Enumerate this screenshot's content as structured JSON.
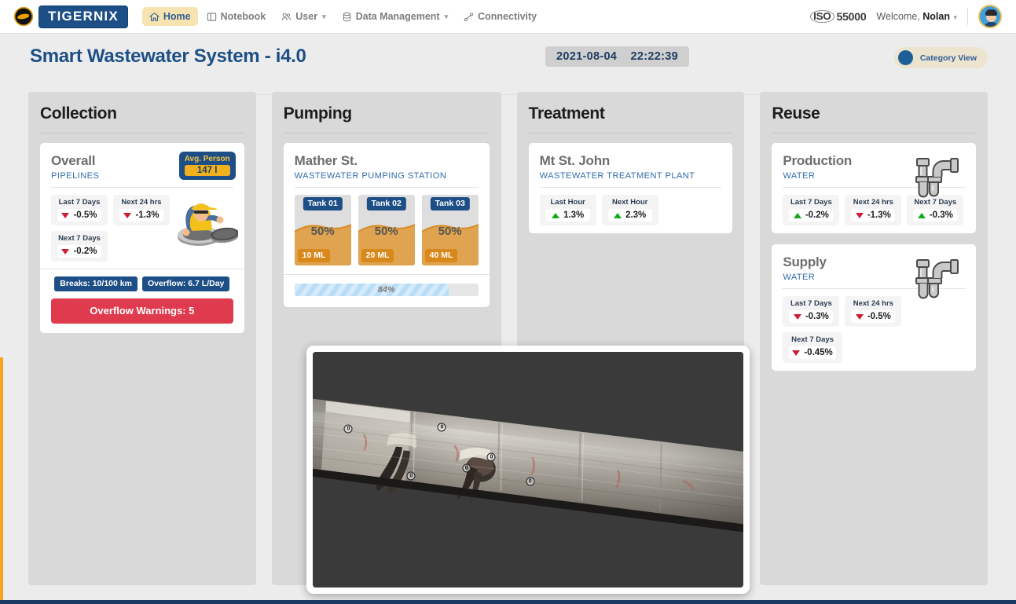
{
  "navbar": {
    "brand_name": "TIGERNIX",
    "links": [
      {
        "label": "Home",
        "icon": "home-icon",
        "active": true,
        "caret": false
      },
      {
        "label": "Notebook",
        "icon": "notebook-icon",
        "active": false,
        "caret": false
      },
      {
        "label": "User",
        "icon": "users-icon",
        "active": false,
        "caret": true
      },
      {
        "label": "Data Management",
        "icon": "database-icon",
        "active": false,
        "caret": true
      },
      {
        "label": "Connectivity",
        "icon": "connectivity-icon",
        "active": false,
        "caret": false
      }
    ],
    "iso_seal": "ISO",
    "iso_number": "55000",
    "welcome_prefix": "Welcome,",
    "user_name": "Nolan"
  },
  "header": {
    "title": "Smart Wastewater System - i4.0",
    "date": "2021-08-04",
    "time": "22:22:39",
    "category_view_label": "Category View",
    "accent_color": "#1d4f86",
    "title_color": "#1d4f86"
  },
  "panels": [
    {
      "name": "Collection",
      "cards": [
        {
          "type": "collection",
          "title": "Overall",
          "subtitle": "PIPELINES",
          "avg_badge_title": "Avg. Person",
          "avg_badge_value": "147 l",
          "chips": [
            {
              "label": "Last 7 Days",
              "value": "-0.5%",
              "dir": "down"
            },
            {
              "label": "Next 24 hrs",
              "value": "-1.3%",
              "dir": "down"
            },
            {
              "label": "Next 7 Days",
              "value": "-0.2%",
              "dir": "down"
            }
          ],
          "badges": [
            "Breaks: 10/100 km",
            "Overflow: 6.7 L/Day"
          ],
          "warning_button": "Overflow Warnings: 5",
          "warning_color": "#e03a4e"
        }
      ]
    },
    {
      "name": "Pumping",
      "cards": [
        {
          "type": "pumping",
          "title": "Mather St.",
          "subtitle": "WASTEWATER PUMPING STATION",
          "tanks": [
            {
              "name": "Tank 01",
              "percent": "50%",
              "fill": 50,
              "volume": "10 ML"
            },
            {
              "name": "Tank 02",
              "percent": "50%",
              "fill": 50,
              "volume": "20 ML"
            },
            {
              "name": "Tank 03",
              "percent": "50%",
              "fill": 50,
              "volume": "40 ML"
            }
          ],
          "progress_label": "84%",
          "progress_value": 84
        }
      ]
    },
    {
      "name": "Treatment",
      "cards": [
        {
          "type": "treatment",
          "title": "Mt St. John",
          "subtitle": "WASTEWATER TREATMENT PLANT",
          "chips": [
            {
              "label": "Last Hour",
              "value": "1.3%",
              "dir": "up"
            },
            {
              "label": "Next Hour",
              "value": "2.3%",
              "dir": "up"
            }
          ]
        }
      ]
    },
    {
      "name": "Reuse",
      "cards": [
        {
          "type": "reuse",
          "title": "Production",
          "subtitle": "WATER",
          "icon": "pipe-trap-icon",
          "chips": [
            {
              "label": "Last 7 Days",
              "value": "-0.2%",
              "dir": "up"
            },
            {
              "label": "Next 24 hrs",
              "value": "-1.3%",
              "dir": "down"
            },
            {
              "label": "Next 7 Days",
              "value": "-0.3%",
              "dir": "up"
            }
          ]
        },
        {
          "type": "reuse",
          "title": "Supply",
          "subtitle": "WATER",
          "icon": "pipe-trap-icon",
          "chips": [
            {
              "label": "Last 7 Days",
              "value": "-0.3%",
              "dir": "down"
            },
            {
              "label": "Next 24 hrs",
              "value": "-0.5%",
              "dir": "down"
            },
            {
              "label": "Next 7 Days",
              "value": "-0.45%",
              "dir": "down"
            }
          ]
        }
      ]
    }
  ],
  "scan_overlay": {
    "name": "pipe-scan-viewer",
    "background_color": "#3a3a3a",
    "markers": [
      {
        "x": 8.3,
        "y": 32.6,
        "label": "0"
      },
      {
        "x": 30.0,
        "y": 32.0,
        "label": "0"
      },
      {
        "x": 22.9,
        "y": 52.5,
        "label": "0"
      },
      {
        "x": 35.7,
        "y": 49.2,
        "label": "0"
      },
      {
        "x": 41.5,
        "y": 44.5,
        "label": "0"
      },
      {
        "x": 50.5,
        "y": 55.0,
        "label": "0"
      }
    ]
  }
}
